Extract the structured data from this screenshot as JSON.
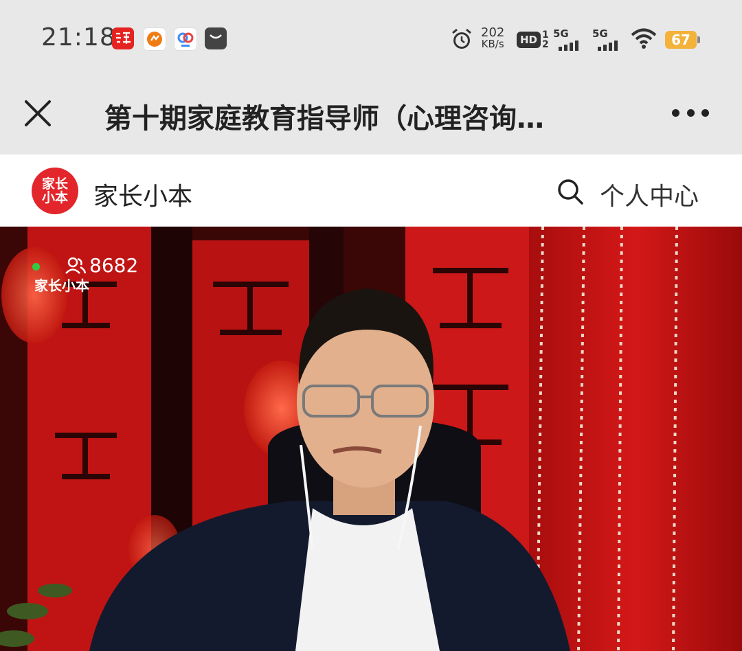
{
  "status_bar": {
    "time": "21:18",
    "net_speed_value": "202",
    "net_speed_unit": "KB/s",
    "hd": "HD",
    "hd_sub_top": "1",
    "hd_sub_bottom": "2",
    "sim1_label": "5G",
    "sim2_label": "5G",
    "battery": "67",
    "notif_icons": [
      "news-app-icon",
      "weibo-app-icon",
      "baidu-netdisk-icon",
      "message-app-icon"
    ],
    "colors": {
      "battery": "#f3b23a",
      "background": "#e8e8e8"
    }
  },
  "title_bar": {
    "title": "第十期家庭教育指导师（心理咨询…",
    "close_icon": "close-icon",
    "more_icon": "more-icon"
  },
  "site_header": {
    "logo_line1": "家长",
    "logo_line2": "小本",
    "brand_name": "家长小本",
    "search_icon": "search-icon",
    "personal_center": "个人中心",
    "colors": {
      "brand": "#e2262b"
    }
  },
  "video": {
    "viewer_count": "8682",
    "watermark": "家长小本",
    "live_dot_color": "#2ecc40"
  }
}
